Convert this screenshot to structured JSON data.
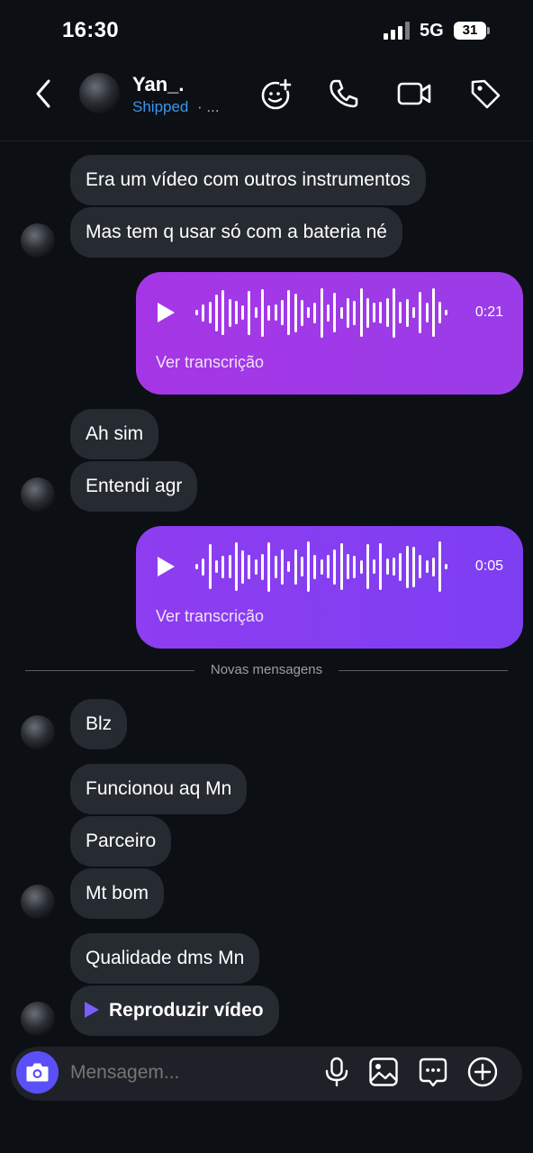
{
  "status_bar": {
    "time": "16:30",
    "network": "5G",
    "battery": "31"
  },
  "header": {
    "contact_name": "Yan_.",
    "contact_status": "Shipped",
    "contact_more": "· ...",
    "icons": [
      "back-icon",
      "avatar",
      "sticker-add-icon",
      "phone-icon",
      "video-camera-icon",
      "tag-icon"
    ]
  },
  "messages": [
    {
      "from": "them",
      "text": "Era um vídeo com outros instrumentos"
    },
    {
      "from": "them",
      "text": "Mas tem q usar só com a bateria né"
    },
    {
      "from": "me",
      "type": "voice",
      "duration": "0:21",
      "transcript_label": "Ver transcrição"
    },
    {
      "from": "them",
      "text": "Ah sim"
    },
    {
      "from": "them",
      "text": "Entendi agr"
    },
    {
      "from": "me",
      "type": "voice",
      "duration": "0:05",
      "transcript_label": "Ver transcrição"
    },
    {
      "from": "them",
      "text": "Blz"
    },
    {
      "from": "them",
      "text": "Funcionou aq Mn"
    },
    {
      "from": "them",
      "text": "Parceiro"
    },
    {
      "from": "them",
      "text": "Mt bom"
    },
    {
      "from": "them",
      "text": "Qualidade dms Mn"
    },
    {
      "from": "them",
      "type": "video",
      "text": "Reproduzir vídeo"
    }
  ],
  "new_messages_divider": "Novas mensagens",
  "composer": {
    "placeholder": "Mensagem...",
    "icons": [
      "camera-icon",
      "microphone-icon",
      "gallery-icon",
      "sticker-icon",
      "plus-icon"
    ]
  },
  "colors": {
    "background": "#0c0f14",
    "incoming_bubble": "#262a31",
    "voice_bubble_1": "#a536e6",
    "voice_bubble_2": "#8e3df0",
    "accent_blue": "#3897f0",
    "camera_button": "#5b50f7"
  }
}
